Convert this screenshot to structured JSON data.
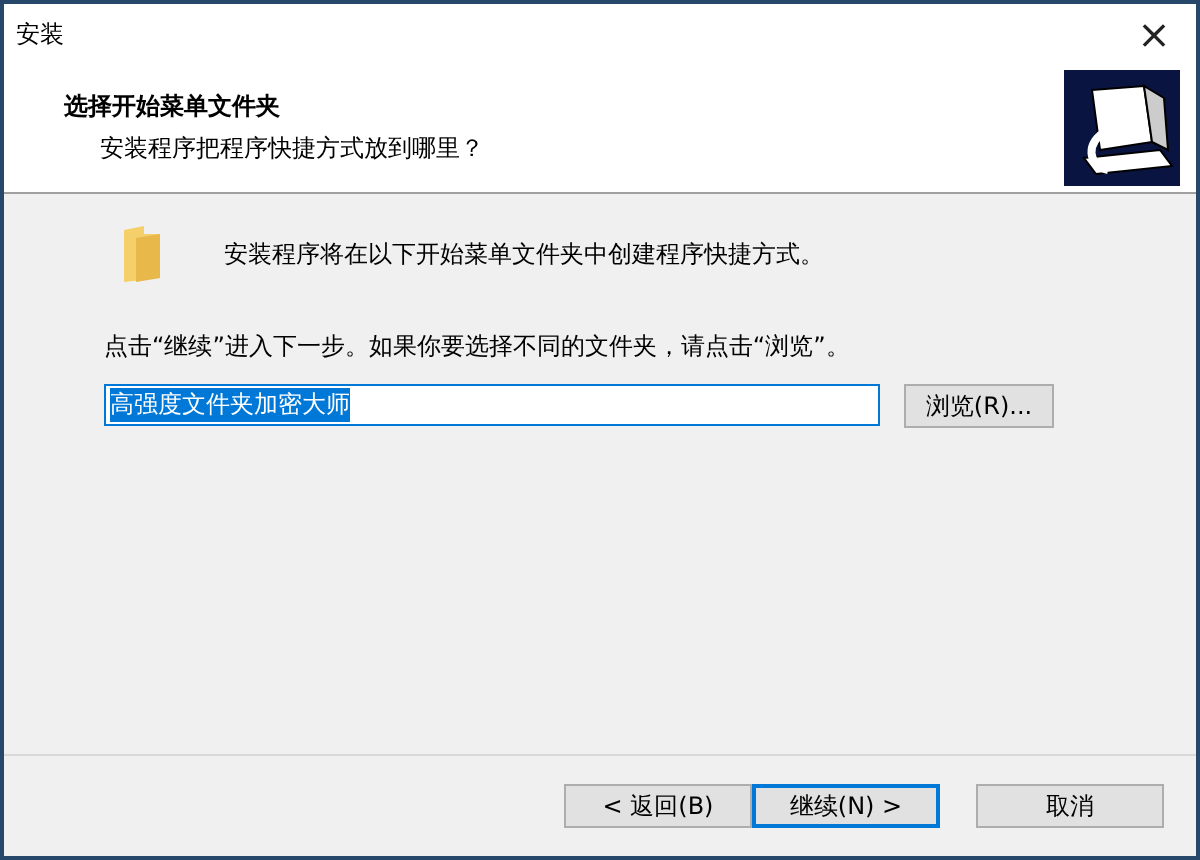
{
  "window": {
    "title": "安装",
    "close": "×"
  },
  "header": {
    "title": "选择开始菜单文件夹",
    "subtitle": "安装程序把程序快捷方式放到哪里？"
  },
  "body": {
    "intro": "安装程序将在以下开始菜单文件夹中创建程序快捷方式。",
    "instruction": "点击“继续”进入下一步。如果你要选择不同的文件夹，请点击“浏览”。",
    "folder_field": {
      "value": "高强度文件夹加密大师",
      "selected": true
    },
    "browse_button": "浏览(R)..."
  },
  "buttons": [
    {
      "label": "< 返回(B)",
      "focused": false
    },
    {
      "label": "继续(N) >",
      "focused": true
    },
    {
      "label": "取消",
      "focused": false
    }
  ]
}
